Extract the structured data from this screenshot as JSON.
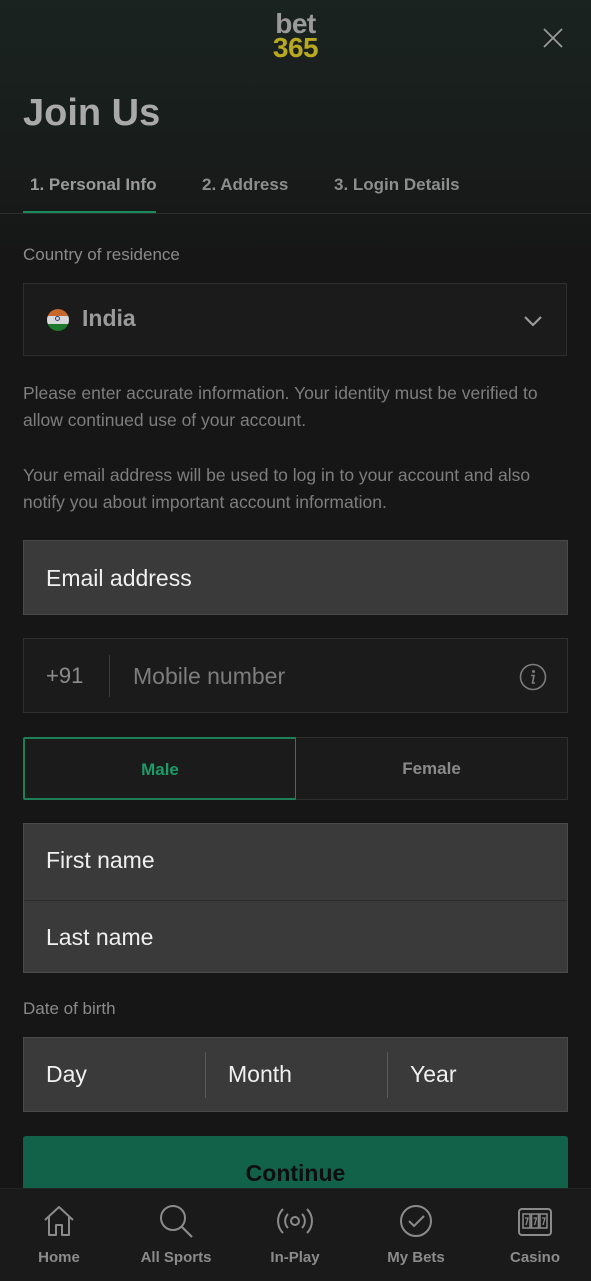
{
  "header": {
    "logo_line1": "bet",
    "logo_line2": "365",
    "title": "Join Us"
  },
  "tabs": [
    {
      "label": "1. Personal Info",
      "active": true
    },
    {
      "label": "2. Address",
      "active": false
    },
    {
      "label": "3. Login Details",
      "active": false
    }
  ],
  "country": {
    "label": "Country of residence",
    "value": "India",
    "flag": "india-flag"
  },
  "info_text_1": "Please enter accurate information. Your identity must be verified to allow continued use of your account.",
  "info_text_2": "Your email address will be used to log in to your account and also notify you about important account information.",
  "email": {
    "placeholder": "Email address"
  },
  "mobile": {
    "prefix": "+91",
    "placeholder": "Mobile number"
  },
  "gender": {
    "male": "Male",
    "female": "Female",
    "selected": "Male"
  },
  "first_name": {
    "placeholder": "First name"
  },
  "last_name": {
    "placeholder": "Last name"
  },
  "dob": {
    "label": "Date of birth",
    "day": "Day",
    "month": "Month",
    "year": "Year"
  },
  "continue_label": "Continue",
  "nav": [
    {
      "label": "Home",
      "icon": "home-icon"
    },
    {
      "label": "All Sports",
      "icon": "search-icon"
    },
    {
      "label": "In-Play",
      "icon": "in-play-icon"
    },
    {
      "label": "My Bets",
      "icon": "check-circle-icon"
    },
    {
      "label": "Casino",
      "icon": "slot-machine-icon"
    }
  ],
  "colors": {
    "accent_green": "#1d7e57",
    "logo_yellow": "#b8a91f",
    "background": "#161616"
  }
}
